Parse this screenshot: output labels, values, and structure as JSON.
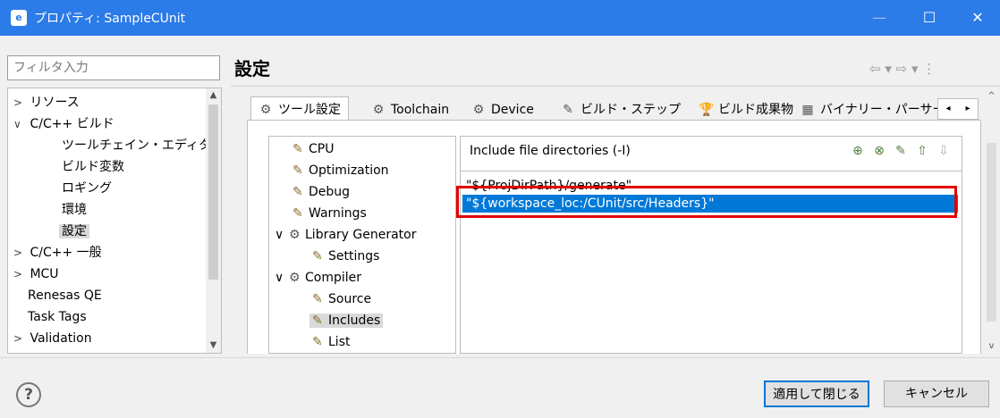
{
  "window": {
    "app_icon": "e-icon",
    "title": "プロパティ: SampleCUnit",
    "minimize": "—",
    "maximize": "☐",
    "close": "✕"
  },
  "filter": {
    "placeholder": "フィルタ入力"
  },
  "sidebar": {
    "items": [
      {
        "label": "リソース",
        "arrow": ">"
      },
      {
        "label": "C/C++ ビルド",
        "arrow": "∨"
      },
      {
        "label": "ツールチェイン・エディター"
      },
      {
        "label": "ビルド変数"
      },
      {
        "label": "ロギング"
      },
      {
        "label": "環境"
      },
      {
        "label": "設定"
      },
      {
        "label": "C/C++ 一般",
        "arrow": ">"
      },
      {
        "label": "MCU",
        "arrow": ">"
      },
      {
        "label": "Renesas QE"
      },
      {
        "label": "Task Tags"
      },
      {
        "label": "Validation",
        "arrow": ">"
      }
    ]
  },
  "main": {
    "heading": "設定",
    "nav": "⇦ ▾ ⇨ ▾ ⋮",
    "tabs": [
      {
        "label": "ツール設定",
        "icon": "⚙"
      },
      {
        "label": "Toolchain",
        "icon": "⚙"
      },
      {
        "label": "Device",
        "icon": "⚙"
      },
      {
        "label": "ビルド・ステップ",
        "icon": "✎"
      },
      {
        "label": "ビルド成果物",
        "icon": "🏆"
      },
      {
        "label": "バイナリー・パーサー",
        "icon": "▦"
      }
    ],
    "tab_scroll_left": "◂",
    "tab_scroll_right": "▸"
  },
  "tool_tree": [
    {
      "label": "CPU"
    },
    {
      "label": "Optimization"
    },
    {
      "label": "Debug"
    },
    {
      "label": "Warnings"
    },
    {
      "label": "Library Generator",
      "arrow": "∨"
    },
    {
      "label": "Settings"
    },
    {
      "label": "Compiler",
      "arrow": "∨"
    },
    {
      "label": "Source"
    },
    {
      "label": "Includes"
    },
    {
      "label": "List"
    }
  ],
  "includes": {
    "label": "Include file directories (-I)",
    "tools": [
      "⊕",
      "⊗",
      "✎",
      "⇧",
      "⇩"
    ],
    "rows": [
      "\"${ProjDirPath}/generate\"",
      "\"${workspace_loc:/CUnit/src/Headers}\""
    ]
  },
  "footer": {
    "help": "?",
    "apply_close": "適用して閉じる",
    "cancel": "キャンセル"
  },
  "colors": {
    "titlebar": "#2b7be9",
    "selection": "#0078d7",
    "highlight_box": "#e00000"
  }
}
